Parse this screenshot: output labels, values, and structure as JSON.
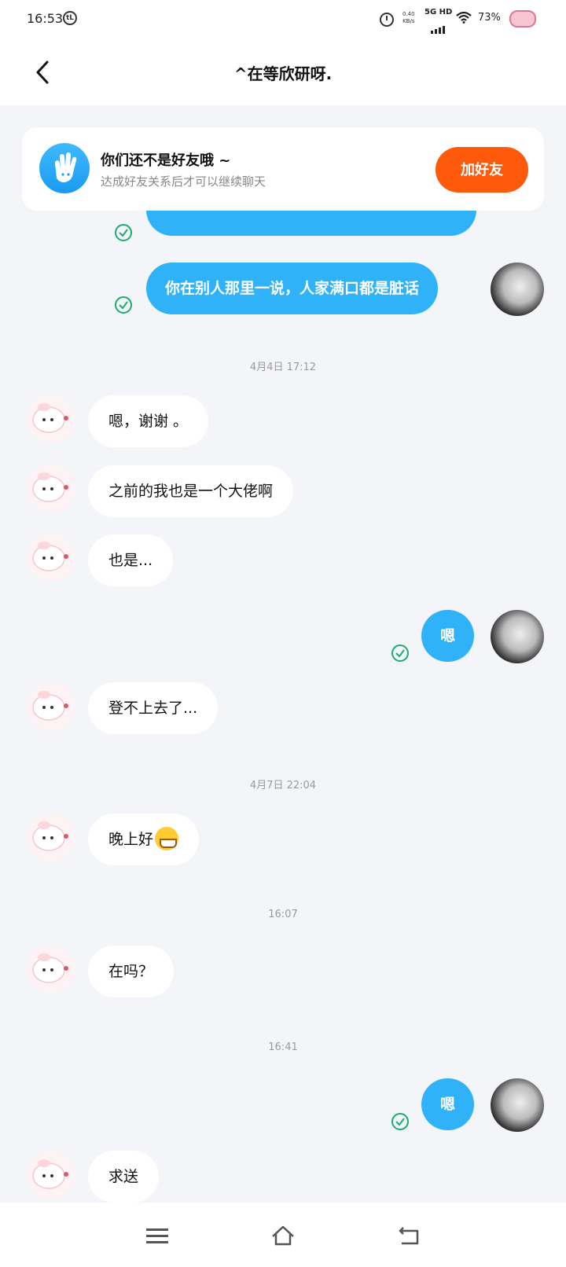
{
  "status_bar": {
    "time": "16:53",
    "circle_icon_text": "⑨",
    "speed_top": "0.40",
    "speed_bottom": "KB/s",
    "network": "5G HD",
    "battery": "73%"
  },
  "header": {
    "title": "^在等欣研呀."
  },
  "friend_card": {
    "title": "你们还不是好友哦 ~",
    "subtitle": "达成好友关系后才可以继续聊天",
    "add_button": "加好友"
  },
  "messages": {
    "m1_out": "你在别人那里一说，人家满口都是脏话",
    "ts1": "4月4日 17:12",
    "m2_in": "嗯，谢谢 。",
    "m3_in": "之前的我也是一个大佬啊",
    "m4_in": "也是...",
    "m5_out": "嗯",
    "m6_in": "登不上去了...",
    "ts2": "4月7日 22:04",
    "m7_in": "晚上好",
    "ts3": "16:07",
    "m8_in": "在吗？",
    "ts4": "16:41",
    "m9_out": "嗯",
    "m10_in": "求送"
  },
  "colors": {
    "accent_blue": "#2fb2f7",
    "add_orange": "#ff5a0c",
    "check_green": "#1aad6b"
  }
}
